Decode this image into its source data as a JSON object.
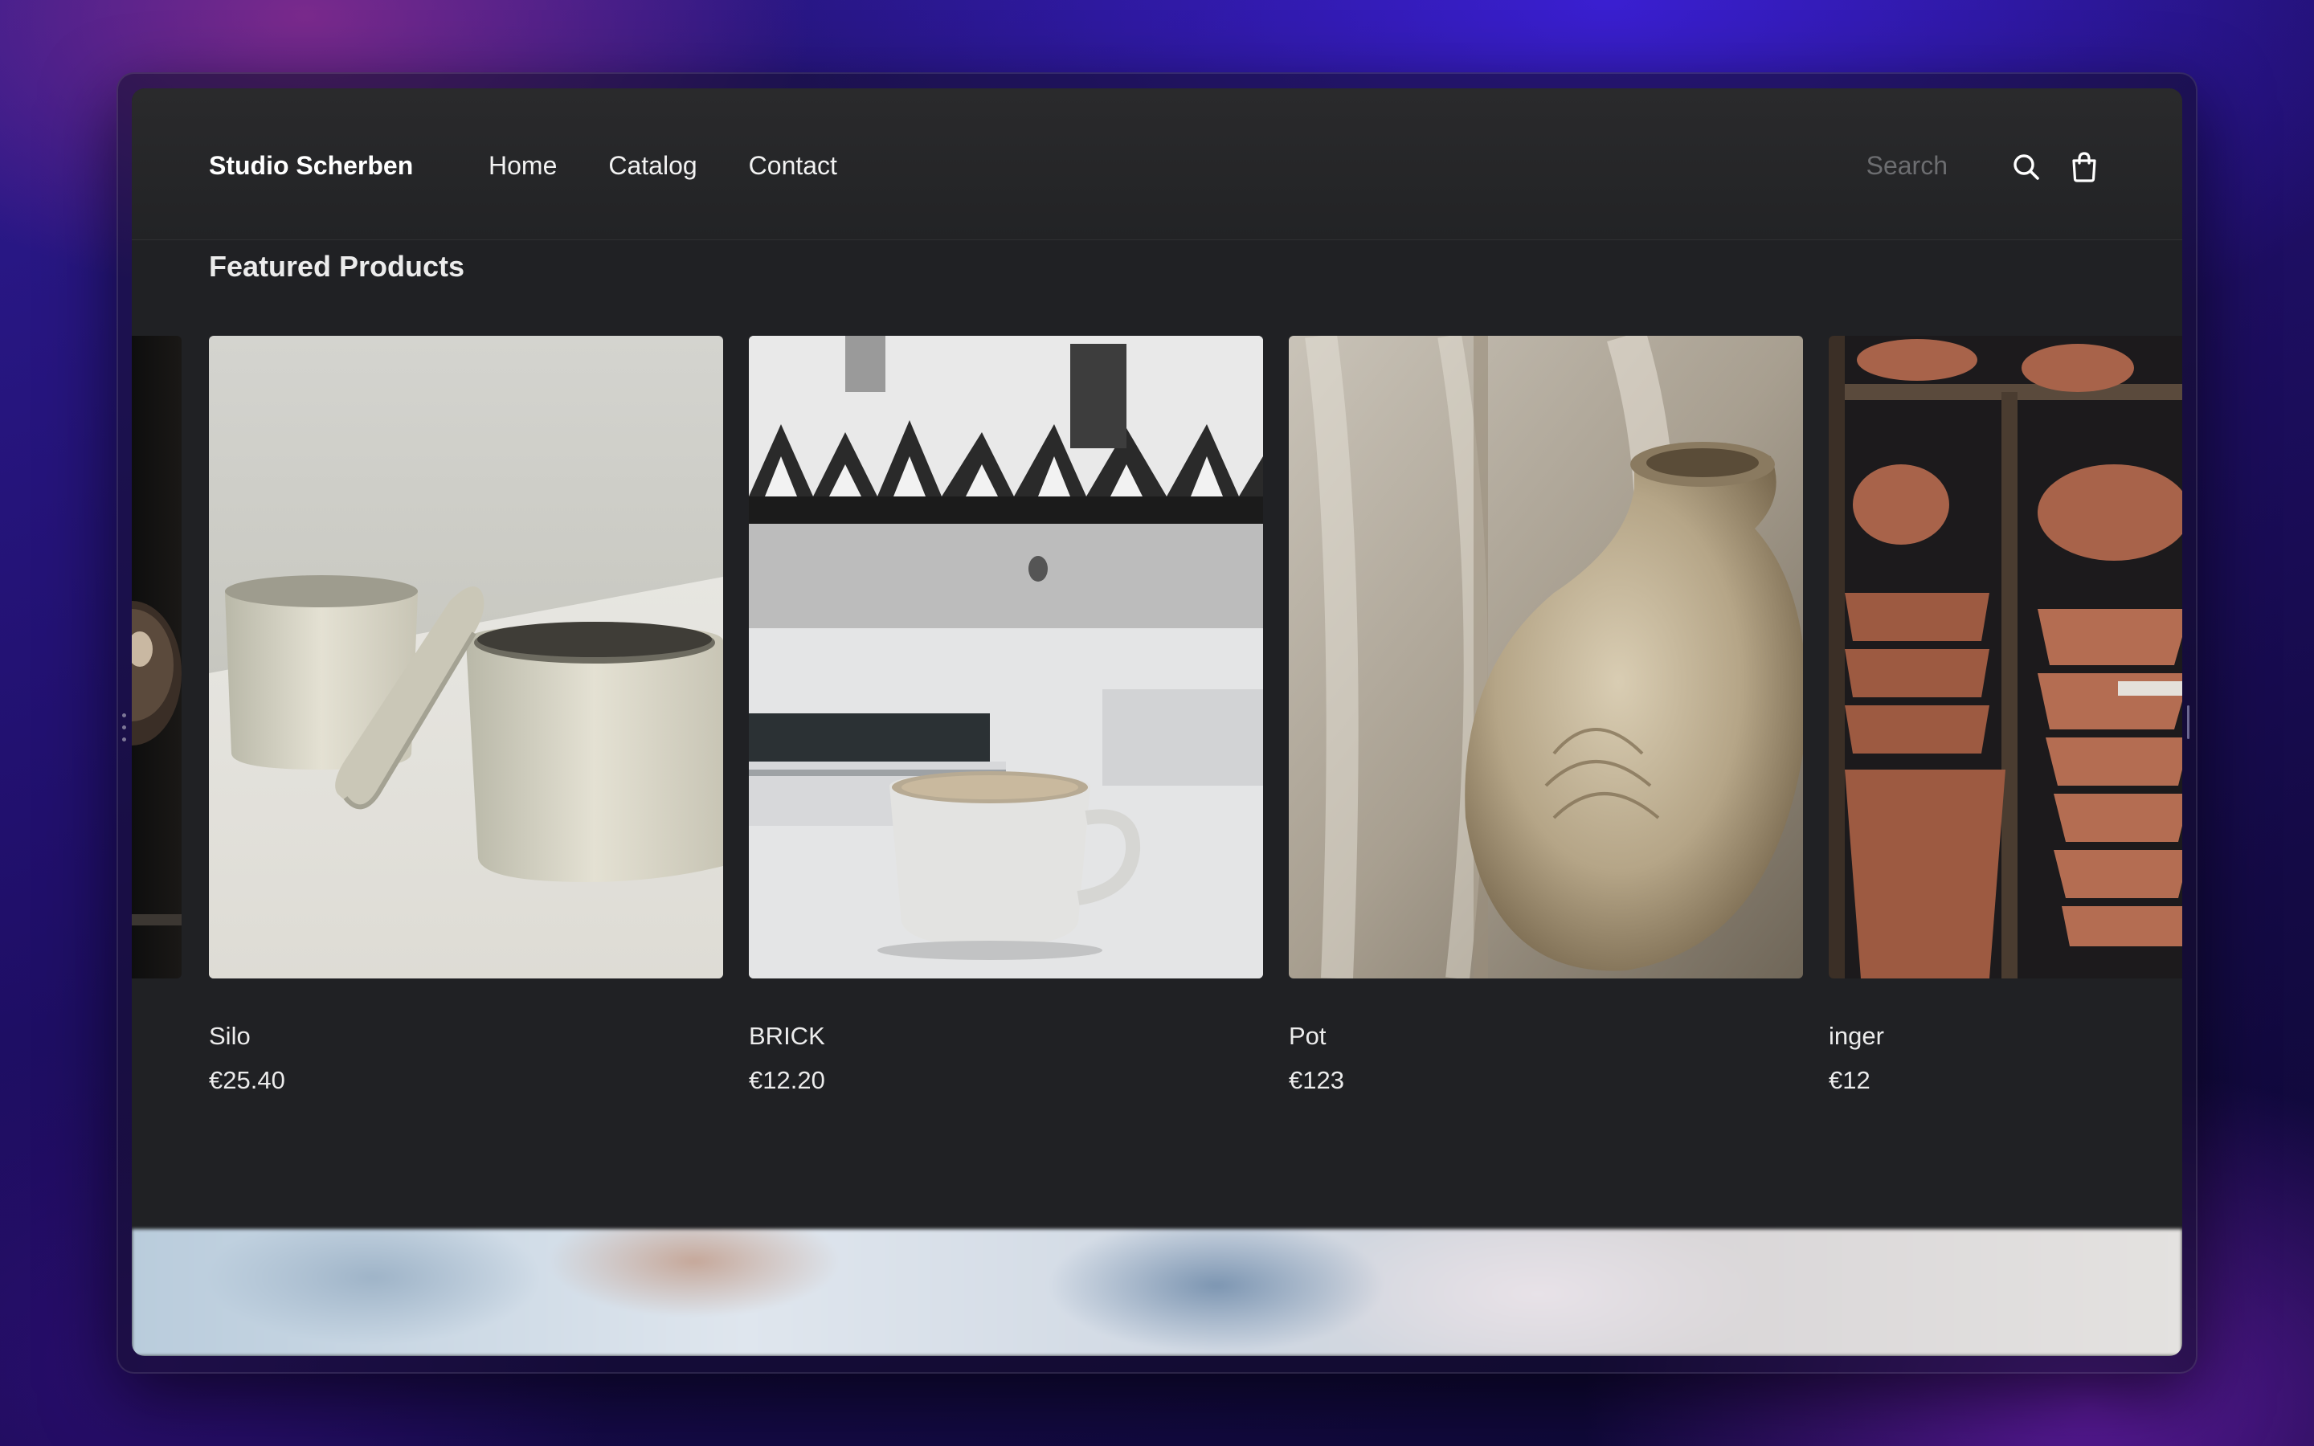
{
  "store": {
    "name": "Studio Scherben",
    "nav": [
      "Home",
      "Catalog",
      "Contact"
    ],
    "search": {
      "placeholder": "Search"
    }
  },
  "featured": {
    "title": "Featured Products",
    "products": [
      {
        "name": "Silo",
        "price": "€25.40"
      },
      {
        "name": "BRICK",
        "price": "€12.20"
      },
      {
        "name": "Pot",
        "price": "€123"
      },
      {
        "name": "inger",
        "price": "€12"
      }
    ]
  },
  "icons": {
    "search": "search-icon",
    "cart": "shopping-bag-icon"
  },
  "colors": {
    "background": "#202124",
    "text": "#ececec",
    "placeholder": "#6c6d70"
  }
}
